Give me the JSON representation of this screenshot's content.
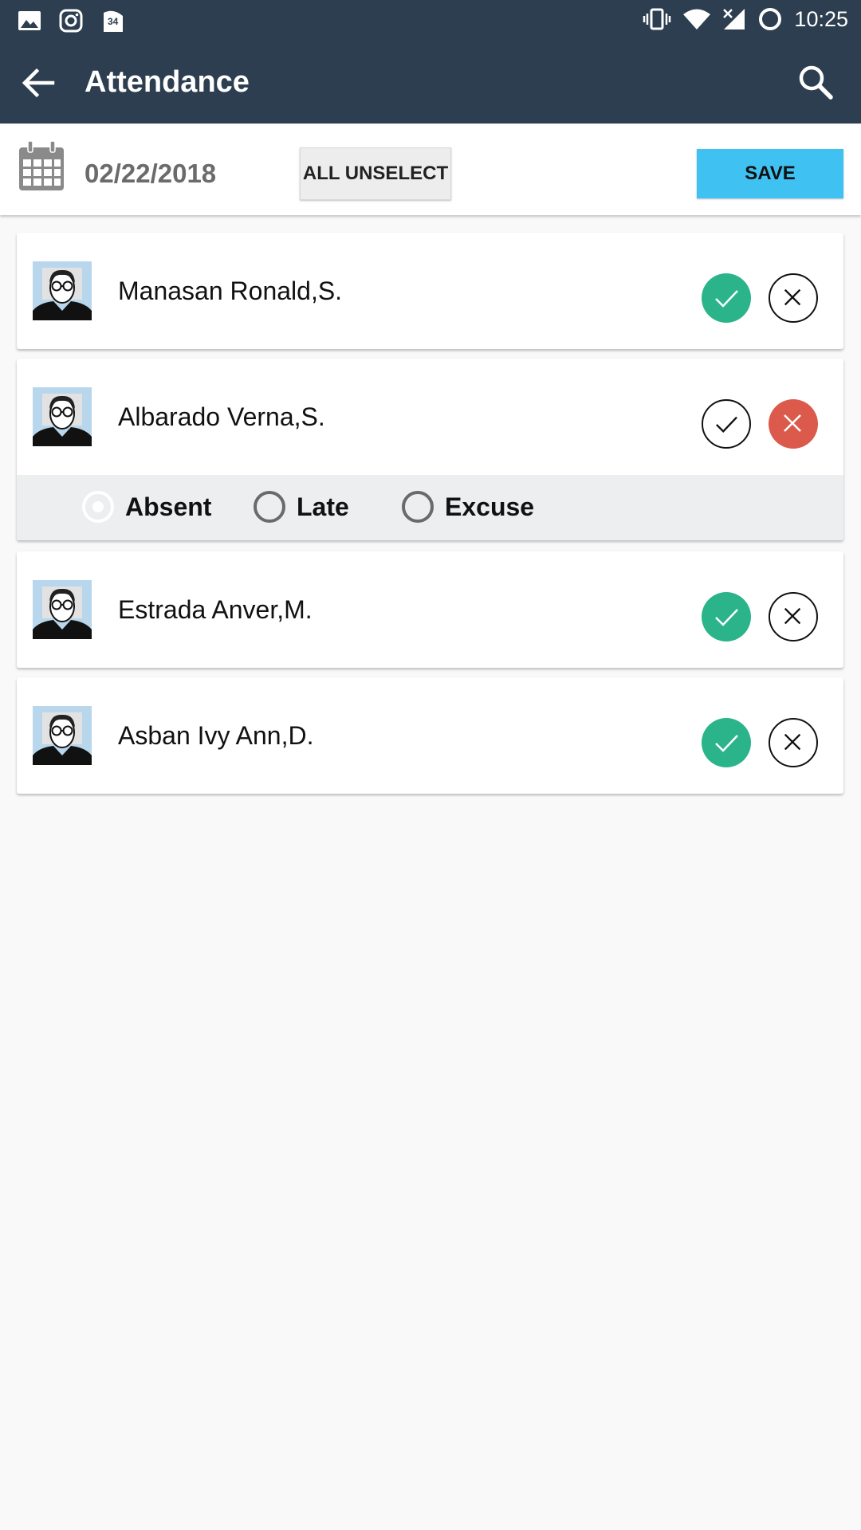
{
  "status": {
    "time": "10:25",
    "notification_badge": "34"
  },
  "appbar": {
    "title": "Attendance"
  },
  "toolbar": {
    "date": "02/22/2018",
    "unselect_label": "ALL UNSELECT",
    "save_label": "SAVE"
  },
  "students": [
    {
      "name": "Manasan Ronald,S.",
      "status": "present"
    },
    {
      "name": "Albarado Verna,S.",
      "status": "absent"
    },
    {
      "name": "Estrada Anver,M.",
      "status": "present"
    },
    {
      "name": "Asban Ivy Ann,D.",
      "status": "present"
    }
  ],
  "absence_reasons": {
    "options": [
      "Absent",
      "Late",
      "Excuse"
    ],
    "selected": "Absent"
  },
  "colors": {
    "bar": "#2d3e50",
    "present": "#2bb48a",
    "absent": "#dc5a4c",
    "save": "#3fc2f1"
  }
}
